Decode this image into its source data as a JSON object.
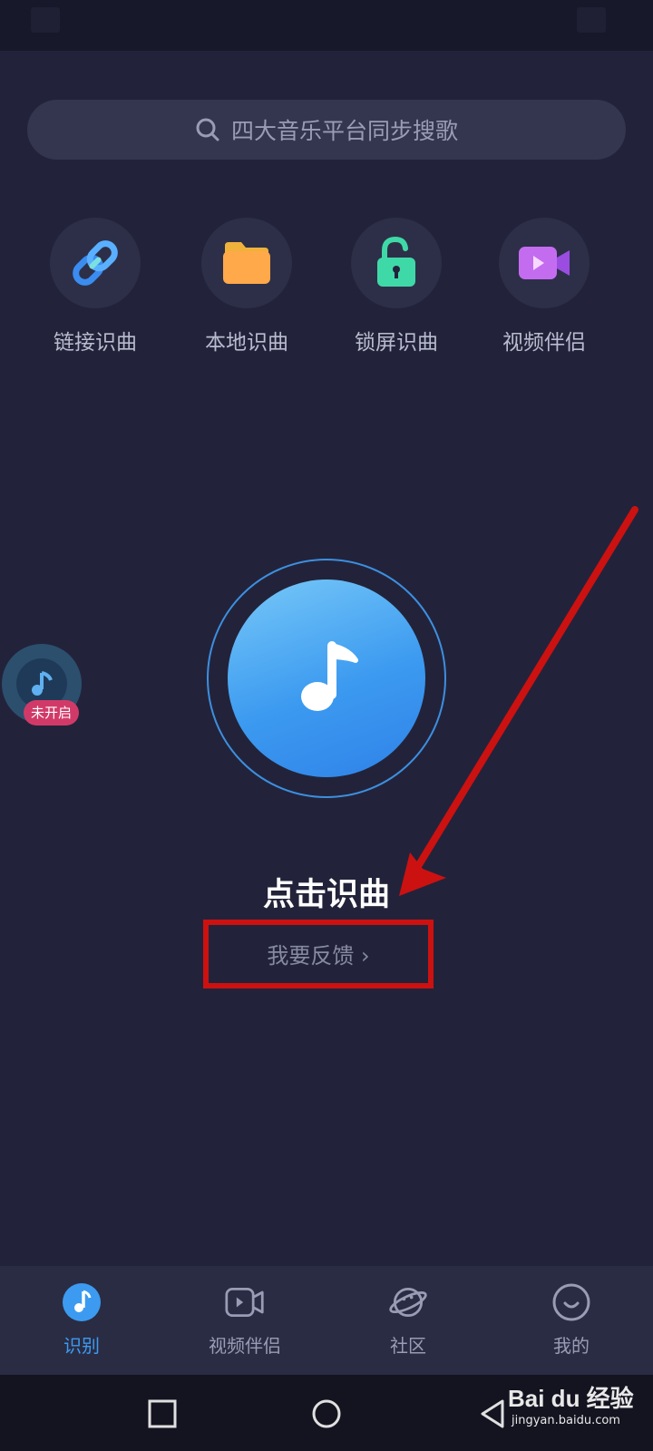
{
  "search": {
    "placeholder": "四大音乐平台同步搜歌",
    "icon": "search-icon"
  },
  "quick_actions": [
    {
      "label": "链接识曲",
      "icon": "link-icon"
    },
    {
      "label": "本地识曲",
      "icon": "folder-icon"
    },
    {
      "label": "锁屏识曲",
      "icon": "unlock-icon"
    },
    {
      "label": "视频伴侣",
      "icon": "video-icon"
    }
  ],
  "floating_widget": {
    "badge": "未开启",
    "icon": "music-note-icon"
  },
  "recognize": {
    "title": "点击识曲",
    "feedback": "我要反馈 ›"
  },
  "tabs": [
    {
      "label": "识别",
      "icon": "music-note-icon",
      "active": true
    },
    {
      "label": "视频伴侣",
      "icon": "video-icon",
      "active": false
    },
    {
      "label": "社区",
      "icon": "planet-icon",
      "active": false
    },
    {
      "label": "我的",
      "icon": "smile-icon",
      "active": false
    }
  ],
  "watermark": {
    "main": "Bai du 经验",
    "sub": "jingyan.baidu.com"
  },
  "colors": {
    "accent": "#3c9bf0",
    "background": "#22233a",
    "annotation": "#cc1111"
  }
}
